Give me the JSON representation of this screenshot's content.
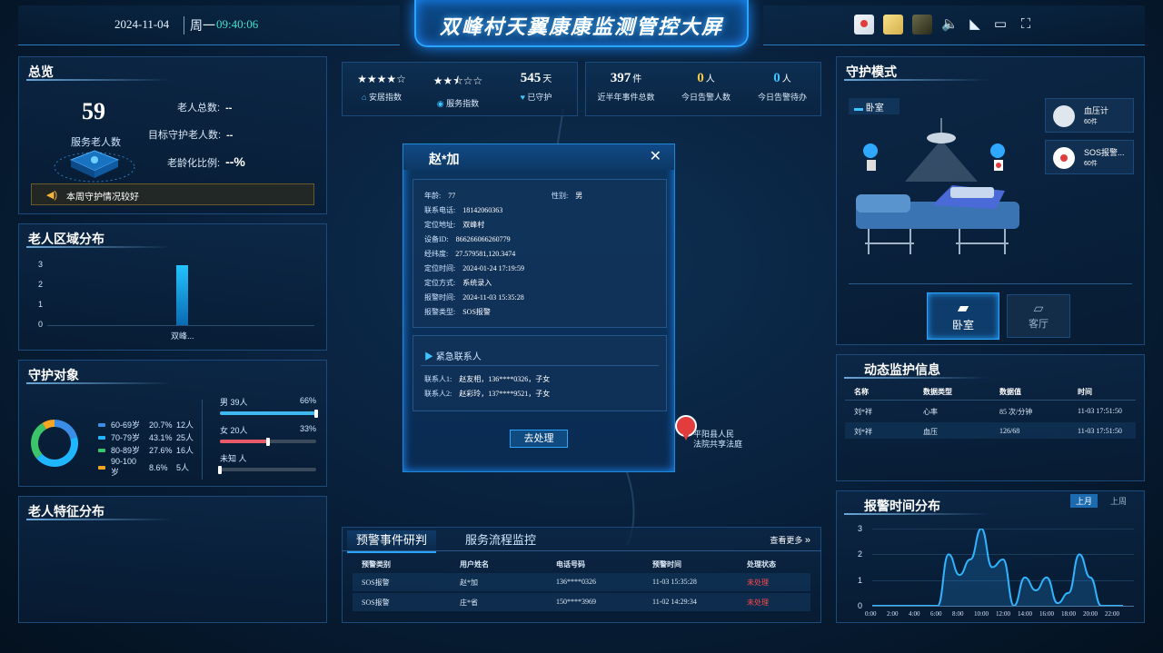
{
  "header": {
    "date": "2024-11-04",
    "weekday": "周一",
    "time": "09:40:06",
    "title": "双峰村天翼康康监测管控大屏"
  },
  "overview": {
    "title": "总览",
    "service_count": "59",
    "service_label": "服务老人数",
    "total_elders_label": "老人总数:",
    "total_elders_value": "--",
    "target_elders_label": "目标守护老人数:",
    "target_elders_value": "--",
    "aging_ratio_label": "老龄化比例:",
    "aging_ratio_value": "--%",
    "notice": "本周守护情况较好"
  },
  "region": {
    "title": "老人区域分布",
    "chart_data": {
      "type": "bar",
      "categories": [
        "双峰..."
      ],
      "values": [
        3
      ],
      "ylim": [
        0,
        3
      ],
      "yticks": [
        "3",
        "2",
        "1",
        "0"
      ]
    }
  },
  "guard": {
    "title": "守护对象",
    "age_legend": [
      {
        "range": "60-69岁",
        "pct": "20.7%",
        "count": "12人",
        "color": "#3a8ee6"
      },
      {
        "range": "70-79岁",
        "pct": "43.1%",
        "count": "25人",
        "color": "#1fb5ff"
      },
      {
        "range": "80-89岁",
        "pct": "27.6%",
        "count": "16人",
        "color": "#3cc46a"
      },
      {
        "range": "90-100岁",
        "pct": "8.6%",
        "count": "5人",
        "color": "#f5a623"
      }
    ],
    "gender": [
      {
        "label": "男 39人",
        "pct": "66%",
        "ratio": 0.66,
        "color": "#3fb8f0"
      },
      {
        "label": "女 20人",
        "pct": "33%",
        "ratio": 0.33,
        "color": "#e65a6a"
      },
      {
        "label": "未知 人",
        "pct": "",
        "ratio": 0,
        "color": "#888"
      }
    ]
  },
  "features": {
    "title": "老人特征分布"
  },
  "stats": {
    "comfort_label": "安居指数",
    "service_label": "服务指数",
    "guarded_value": "545",
    "guarded_unit": "天",
    "guarded_label": "已守护",
    "events_value": "397",
    "events_unit": "件",
    "events_label": "近半年事件总数",
    "alarm_value": "0",
    "alarm_unit": "人",
    "alarm_label": "今日告警人数",
    "pending_value": "0",
    "pending_unit": "人",
    "pending_label": "今日告警待办"
  },
  "modal": {
    "name": "赵*加",
    "age_label": "年龄:",
    "age": "77",
    "gender_label": "性别:",
    "gender": "男",
    "phone_label": "联系电话:",
    "phone": "18142060363",
    "address_label": "定位地址:",
    "address": "双峰村",
    "device_label": "设备ID:",
    "device": "866266066260779",
    "coords_label": "经纬度:",
    "coords": "27.579581,120.3474",
    "loc_time_label": "定位时间:",
    "loc_time": "2024-01-24 17:19:59",
    "loc_method_label": "定位方式:",
    "loc_method": "系统录入",
    "alarm_time_label": "报警时间:",
    "alarm_time": "2024-11-03 15:35:28",
    "alarm_type_label": "报警类型:",
    "alarm_type": "SOS报警",
    "contacts_title": "紧急联系人",
    "contact1_label": "联系人1:",
    "contact1": "赵友相，136****0326，子女",
    "contact2_label": "联系人2:",
    "contact2": "赵彩玲，137****9521，子女",
    "action": "去处理"
  },
  "map_pin": {
    "line1": "平阳县人民",
    "line2": "法院共享法庭"
  },
  "events": {
    "tab_active": "预警事件研判",
    "tab_other": "服务流程监控",
    "more": "查看更多",
    "headers": [
      "预警类别",
      "用户姓名",
      "电话号码",
      "预警时间",
      "处理状态"
    ],
    "rows": [
      [
        "SOS报警",
        "赵*加",
        "136****0326",
        "11-03 15:35:28",
        "未处理"
      ],
      [
        "SOS报警",
        "庄*省",
        "150****3969",
        "11-02 14:29:34",
        "未处理"
      ]
    ]
  },
  "guard_mode": {
    "title": "守护模式",
    "room": "卧室",
    "devices": [
      {
        "name": "血压计",
        "count": "60件"
      },
      {
        "name": "SOS报警...",
        "count": "60件"
      }
    ],
    "room_buttons": [
      "卧室",
      "客厅"
    ]
  },
  "monitor": {
    "title": "动态监护信息",
    "headers": [
      "名称",
      "数据类型",
      "数据值",
      "时间"
    ],
    "rows": [
      [
        "刘*祥",
        "心率",
        "85 次/分钟",
        "11-03 17:51:50"
      ],
      [
        "刘*祥",
        "血压",
        "126/68",
        "11-03 17:51:50"
      ]
    ]
  },
  "alarm_dist": {
    "title": "报警时间分布",
    "toggle": [
      "上月",
      "上周"
    ],
    "chart_data": {
      "type": "line",
      "x": [
        "0:00",
        "2:00",
        "4:00",
        "6:00",
        "8:00",
        "10:00",
        "12:00",
        "14:00",
        "16:00",
        "18:00",
        "20:00",
        "22:00"
      ],
      "yticks": [
        "3",
        "2",
        "1",
        "0"
      ],
      "ylim": [
        0,
        3
      ],
      "series": [
        {
          "values": [
            0,
            0,
            0,
            0,
            0,
            0,
            0,
            2,
            1.2,
            1.8,
            3,
            1.5,
            1.8,
            0,
            1.1,
            0.6,
            1.1,
            0.1,
            0.5,
            2,
            1.1,
            0,
            0,
            0
          ]
        }
      ]
    }
  }
}
